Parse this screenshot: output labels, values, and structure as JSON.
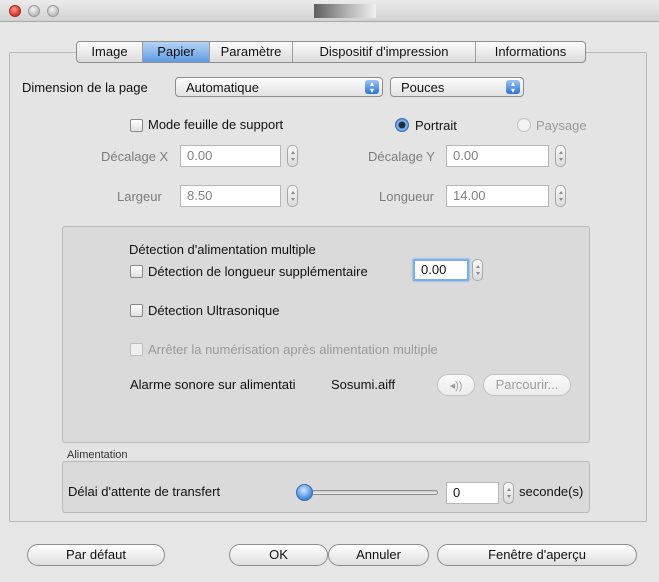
{
  "tabs": [
    {
      "label": "Image",
      "active": false
    },
    {
      "label": "Papier",
      "active": true
    },
    {
      "label": "Paramètre",
      "active": false
    },
    {
      "label": "Dispositif d'impression",
      "active": false
    },
    {
      "label": "Informations",
      "active": false
    }
  ],
  "page_size": {
    "label": "Dimension de la page",
    "selected": "Automatique",
    "units_selected": "Pouces"
  },
  "carrier_mode": {
    "label": "Mode feuille de support",
    "checked": false
  },
  "orientation": {
    "portrait_label": "Portrait",
    "landscape_label": "Paysage",
    "selected": "Portrait"
  },
  "offset_x": {
    "label": "Décalage X",
    "value": "0.00"
  },
  "offset_y": {
    "label": "Décalage Y",
    "value": "0.00"
  },
  "width": {
    "label": "Largeur",
    "value": "8.50"
  },
  "length": {
    "label": "Longueur",
    "value": "14.00"
  },
  "multifeed": {
    "title": "Détection d'alimentation multiple",
    "length_detect_label": "Détection de longueur supplémentaire",
    "length_detect_value": "0.00",
    "ultrasonic_label": "Détection Ultrasonique",
    "stop_scan_label": "Arrêter la numérisation après alimentation multiple",
    "alarm_label": "Alarme sonore sur alimentati",
    "alarm_file": "Sosumi.aiff",
    "speaker_icon": "speaker-icon",
    "browse_label": "Parcourir..."
  },
  "feeding": {
    "section_label": "Alimentation",
    "timeout_label": "Délai d'attente de transfert",
    "timeout_value": "0",
    "unit_label": "seconde(s)",
    "slider_level": 0
  },
  "buttons": {
    "default": "Par défaut",
    "ok": "OK",
    "cancel": "Annuler",
    "preview": "Fenêtre d'aperçu"
  },
  "colors": {
    "accent": "#3d86e0",
    "close": "#d4332a"
  }
}
